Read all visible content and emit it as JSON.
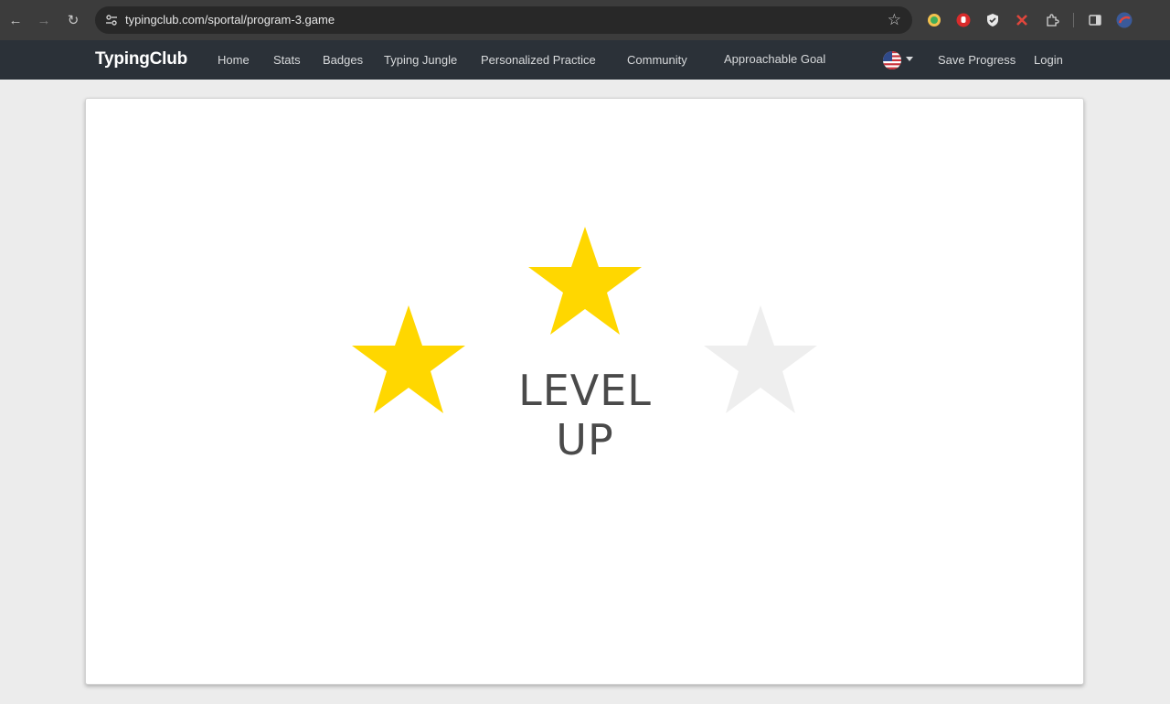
{
  "browser": {
    "url": "typingclub.com/sportal/program-3.game"
  },
  "nav": {
    "brand": "TypingClub",
    "links": [
      "Home",
      "Stats",
      "Badges",
      "Typing Jungle",
      "Personalized Practice",
      "Community",
      "Approachable Goal"
    ],
    "save_progress": "Save Progress",
    "login": "Login"
  },
  "result": {
    "title": "LEVEL UP",
    "stars_earned": 2,
    "stars_total": 3
  },
  "colors": {
    "star_filled": "#FFD700",
    "star_empty": "#EEEEEE",
    "nav_background": "#2B3138",
    "browser_bar": "#3C3C3C"
  }
}
